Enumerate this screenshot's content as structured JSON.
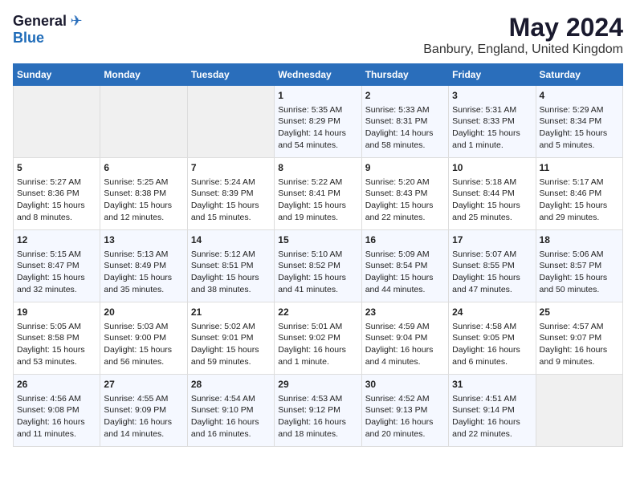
{
  "logo": {
    "general": "General",
    "blue": "Blue"
  },
  "title": "May 2024",
  "subtitle": "Banbury, England, United Kingdom",
  "days_of_week": [
    "Sunday",
    "Monday",
    "Tuesday",
    "Wednesday",
    "Thursday",
    "Friday",
    "Saturday"
  ],
  "weeks": [
    [
      {
        "day": "",
        "content": ""
      },
      {
        "day": "",
        "content": ""
      },
      {
        "day": "",
        "content": ""
      },
      {
        "day": "1",
        "content": "Sunrise: 5:35 AM\nSunset: 8:29 PM\nDaylight: 14 hours\nand 54 minutes."
      },
      {
        "day": "2",
        "content": "Sunrise: 5:33 AM\nSunset: 8:31 PM\nDaylight: 14 hours\nand 58 minutes."
      },
      {
        "day": "3",
        "content": "Sunrise: 5:31 AM\nSunset: 8:33 PM\nDaylight: 15 hours\nand 1 minute."
      },
      {
        "day": "4",
        "content": "Sunrise: 5:29 AM\nSunset: 8:34 PM\nDaylight: 15 hours\nand 5 minutes."
      }
    ],
    [
      {
        "day": "5",
        "content": "Sunrise: 5:27 AM\nSunset: 8:36 PM\nDaylight: 15 hours\nand 8 minutes."
      },
      {
        "day": "6",
        "content": "Sunrise: 5:25 AM\nSunset: 8:38 PM\nDaylight: 15 hours\nand 12 minutes."
      },
      {
        "day": "7",
        "content": "Sunrise: 5:24 AM\nSunset: 8:39 PM\nDaylight: 15 hours\nand 15 minutes."
      },
      {
        "day": "8",
        "content": "Sunrise: 5:22 AM\nSunset: 8:41 PM\nDaylight: 15 hours\nand 19 minutes."
      },
      {
        "day": "9",
        "content": "Sunrise: 5:20 AM\nSunset: 8:43 PM\nDaylight: 15 hours\nand 22 minutes."
      },
      {
        "day": "10",
        "content": "Sunrise: 5:18 AM\nSunset: 8:44 PM\nDaylight: 15 hours\nand 25 minutes."
      },
      {
        "day": "11",
        "content": "Sunrise: 5:17 AM\nSunset: 8:46 PM\nDaylight: 15 hours\nand 29 minutes."
      }
    ],
    [
      {
        "day": "12",
        "content": "Sunrise: 5:15 AM\nSunset: 8:47 PM\nDaylight: 15 hours\nand 32 minutes."
      },
      {
        "day": "13",
        "content": "Sunrise: 5:13 AM\nSunset: 8:49 PM\nDaylight: 15 hours\nand 35 minutes."
      },
      {
        "day": "14",
        "content": "Sunrise: 5:12 AM\nSunset: 8:51 PM\nDaylight: 15 hours\nand 38 minutes."
      },
      {
        "day": "15",
        "content": "Sunrise: 5:10 AM\nSunset: 8:52 PM\nDaylight: 15 hours\nand 41 minutes."
      },
      {
        "day": "16",
        "content": "Sunrise: 5:09 AM\nSunset: 8:54 PM\nDaylight: 15 hours\nand 44 minutes."
      },
      {
        "day": "17",
        "content": "Sunrise: 5:07 AM\nSunset: 8:55 PM\nDaylight: 15 hours\nand 47 minutes."
      },
      {
        "day": "18",
        "content": "Sunrise: 5:06 AM\nSunset: 8:57 PM\nDaylight: 15 hours\nand 50 minutes."
      }
    ],
    [
      {
        "day": "19",
        "content": "Sunrise: 5:05 AM\nSunset: 8:58 PM\nDaylight: 15 hours\nand 53 minutes."
      },
      {
        "day": "20",
        "content": "Sunrise: 5:03 AM\nSunset: 9:00 PM\nDaylight: 15 hours\nand 56 minutes."
      },
      {
        "day": "21",
        "content": "Sunrise: 5:02 AM\nSunset: 9:01 PM\nDaylight: 15 hours\nand 59 minutes."
      },
      {
        "day": "22",
        "content": "Sunrise: 5:01 AM\nSunset: 9:02 PM\nDaylight: 16 hours\nand 1 minute."
      },
      {
        "day": "23",
        "content": "Sunrise: 4:59 AM\nSunset: 9:04 PM\nDaylight: 16 hours\nand 4 minutes."
      },
      {
        "day": "24",
        "content": "Sunrise: 4:58 AM\nSunset: 9:05 PM\nDaylight: 16 hours\nand 6 minutes."
      },
      {
        "day": "25",
        "content": "Sunrise: 4:57 AM\nSunset: 9:07 PM\nDaylight: 16 hours\nand 9 minutes."
      }
    ],
    [
      {
        "day": "26",
        "content": "Sunrise: 4:56 AM\nSunset: 9:08 PM\nDaylight: 16 hours\nand 11 minutes."
      },
      {
        "day": "27",
        "content": "Sunrise: 4:55 AM\nSunset: 9:09 PM\nDaylight: 16 hours\nand 14 minutes."
      },
      {
        "day": "28",
        "content": "Sunrise: 4:54 AM\nSunset: 9:10 PM\nDaylight: 16 hours\nand 16 minutes."
      },
      {
        "day": "29",
        "content": "Sunrise: 4:53 AM\nSunset: 9:12 PM\nDaylight: 16 hours\nand 18 minutes."
      },
      {
        "day": "30",
        "content": "Sunrise: 4:52 AM\nSunset: 9:13 PM\nDaylight: 16 hours\nand 20 minutes."
      },
      {
        "day": "31",
        "content": "Sunrise: 4:51 AM\nSunset: 9:14 PM\nDaylight: 16 hours\nand 22 minutes."
      },
      {
        "day": "",
        "content": ""
      }
    ]
  ]
}
